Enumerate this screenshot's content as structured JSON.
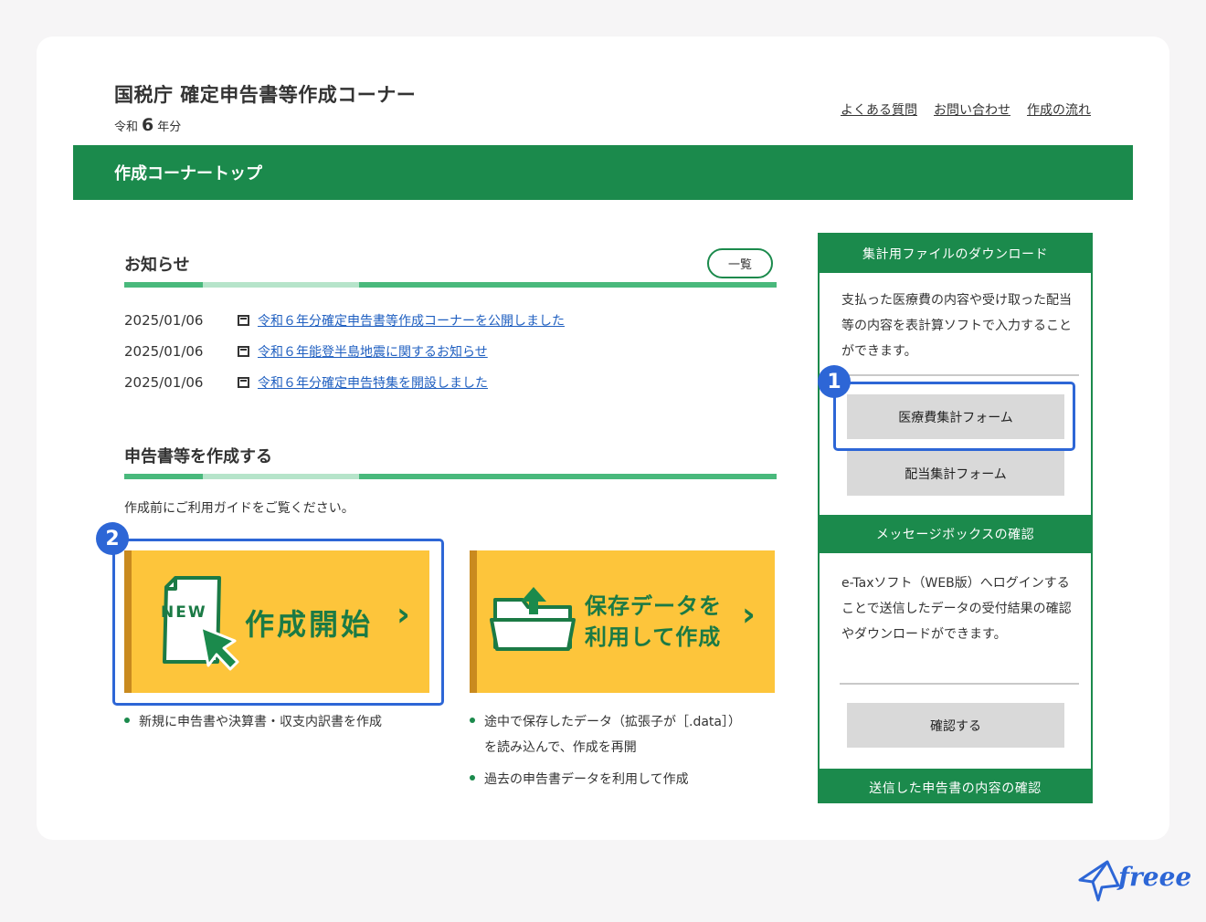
{
  "header": {
    "title": "国税庁 確定申告書等作成コーナー",
    "era": "令和",
    "year": "6",
    "year_suffix": "年分",
    "links": [
      "よくある質問",
      "お問い合わせ",
      "作成の流れ"
    ]
  },
  "nav": {
    "label": "作成コーナートップ"
  },
  "news": {
    "title": "お知らせ",
    "list_button": "一覧",
    "items": [
      {
        "date": "2025/01/06",
        "text": "令和６年分確定申告書等作成コーナーを公開しました"
      },
      {
        "date": "2025/01/06",
        "text": "令和６年能登半島地震に関するお知らせ"
      },
      {
        "date": "2025/01/06",
        "text": "令和６年分確定申告特集を開設しました"
      }
    ]
  },
  "create": {
    "title": "申告書等を作成する",
    "guide": "作成前にご利用ガイドをご覧ください。",
    "new_button": {
      "badge": "NEW",
      "label": "作成開始",
      "chevron": "›"
    },
    "save_button": {
      "label_line1": "保存データを",
      "label_line2": "利用して作成",
      "chevron": "›"
    },
    "new_notes": [
      "新規に申告書や決算書・収支内訳書を作成"
    ],
    "save_notes": [
      "途中で保存したデータ（拡張子が［.data］）",
      "を読み込んで、作成を再開",
      "過去の申告書データを利用して作成"
    ]
  },
  "sidebar": {
    "download": {
      "title": "集計用ファイルのダウンロード",
      "text": "支払った医療費の内容や受け取った配当等の内容を表計算ソフトで入力することができます。",
      "buttons": [
        "医療費集計フォーム",
        "配当集計フォーム"
      ]
    },
    "message": {
      "title": "メッセージボックスの確認",
      "text": "e-Taxソフト（WEB版）へログインすることで送信したデータの受付結果の確認やダウンロードができます。",
      "button": "確認する"
    },
    "sent": {
      "title": "送信した申告書の内容の確認"
    }
  },
  "annotations": {
    "badge1": "1",
    "badge2": "2"
  },
  "brand": {
    "logo": "freee"
  },
  "colors": {
    "green": "#1b8a4c",
    "yellow": "#fdc53b",
    "link": "#1f5fc0",
    "highlight": "#2d66d6"
  }
}
